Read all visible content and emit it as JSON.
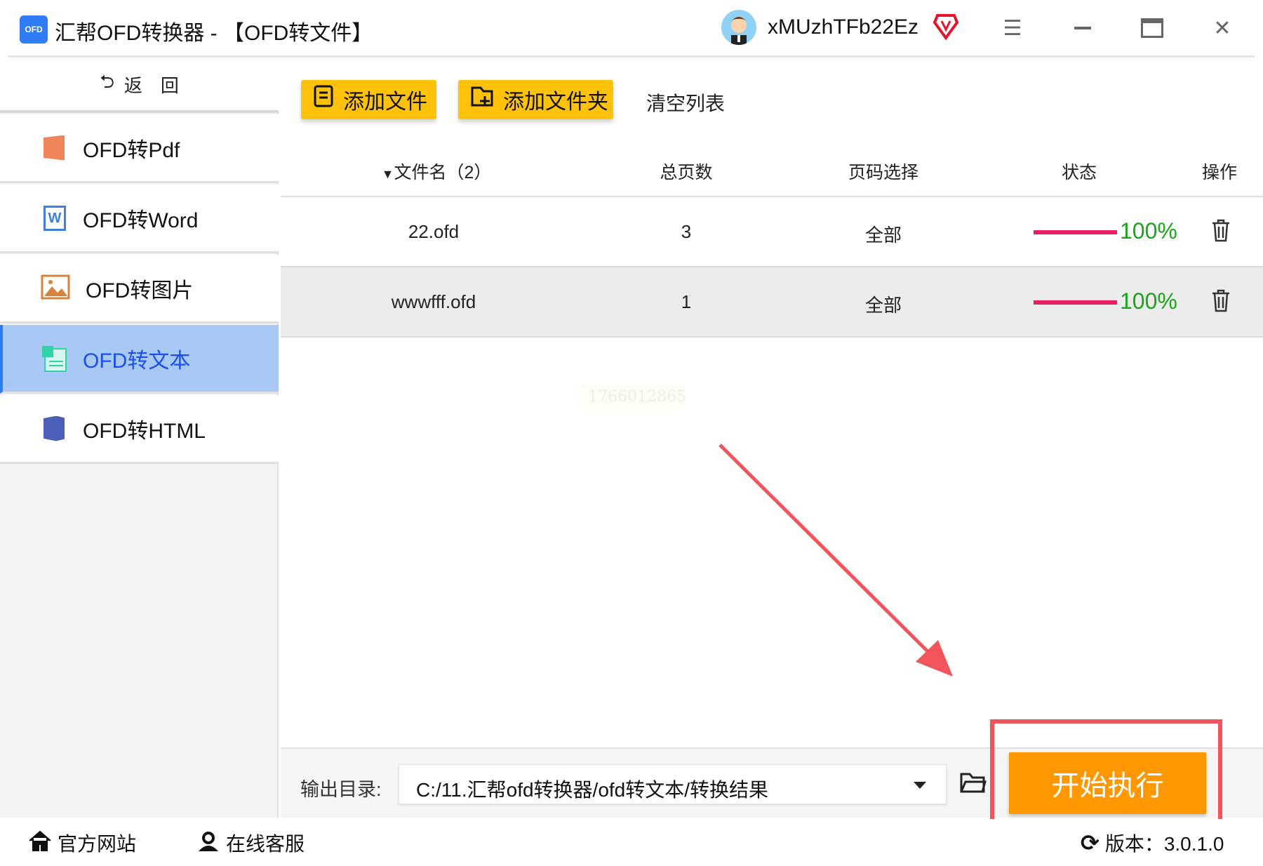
{
  "app": {
    "logo_text": "OFD",
    "title": "汇帮OFD转换器 - 【OFD转文件】",
    "username": "xMUzhTFb22Ez"
  },
  "sidebar": {
    "back_label": "返　回",
    "items": [
      {
        "label": "OFD转Pdf",
        "icon": "pdf-icon",
        "color": "#f0855a"
      },
      {
        "label": "OFD转Word",
        "icon": "word-icon",
        "color": "#3f7fe0"
      },
      {
        "label": "OFD转图片",
        "icon": "image-icon",
        "color": "#d9823a"
      },
      {
        "label": "OFD转文本",
        "icon": "text-icon",
        "color": "#2fd3a8",
        "active": true
      },
      {
        "label": "OFD转HTML",
        "icon": "html-icon",
        "color": "#4b5fb8"
      }
    ]
  },
  "toolbar": {
    "add_file": "添加文件",
    "add_folder": "添加文件夹",
    "clear_list": "清空列表"
  },
  "table": {
    "headers": {
      "filename": "文件名（2）",
      "pages": "总页数",
      "range": "页码选择",
      "status": "状态",
      "action": "操作"
    },
    "rows": [
      {
        "filename": "22.ofd",
        "pages": "3",
        "range": "全部",
        "progress_label": "100%",
        "progress": 100
      },
      {
        "filename": "wwwfff.ofd",
        "pages": "1",
        "range": "全部",
        "progress_label": "100%",
        "progress": 100
      }
    ]
  },
  "watermark": "1766012865",
  "output": {
    "label": "输出目录:",
    "path": "C:/11.汇帮ofd转换器/ofd转文本/转换结果"
  },
  "start_label": "开始执行",
  "footer": {
    "website": "官方网站",
    "support": "在线客服",
    "version": "版本：3.0.1.0"
  },
  "colors": {
    "accent": "#ff9700",
    "button": "#ffc20a",
    "progress": "#e91e63",
    "active_nav": "#a8c9f6"
  }
}
